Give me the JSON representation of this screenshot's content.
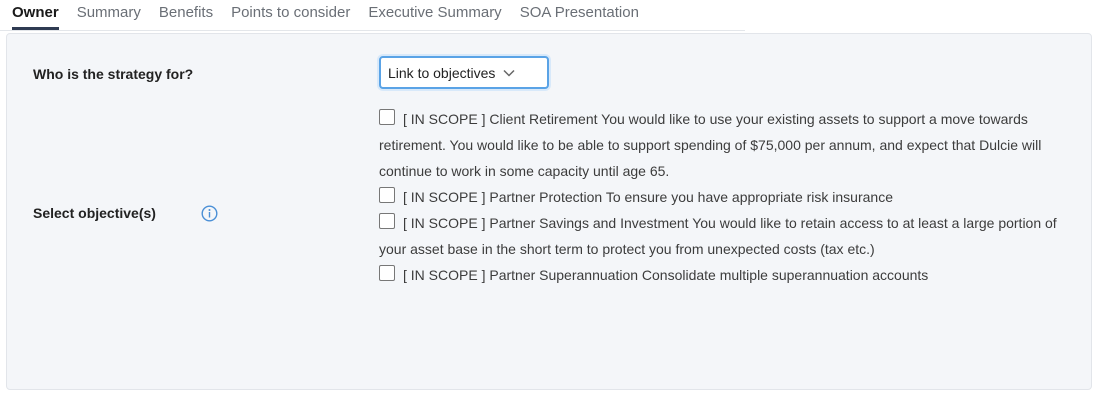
{
  "tabs": [
    {
      "label": "Owner",
      "active": true
    },
    {
      "label": "Summary"
    },
    {
      "label": "Benefits"
    },
    {
      "label": "Points to consider"
    },
    {
      "label": "Executive Summary"
    },
    {
      "label": "SOA Presentation"
    }
  ],
  "form": {
    "strategy_label": "Who is the strategy for?",
    "strategy_value": "Link to objectives",
    "objectives_label": "Select objective(s)",
    "objectives": [
      {
        "text": "[ IN SCOPE ] Client Retirement You would like to use your existing assets to support a move towards retirement. You would like to be able to support spending of $75,000 per annum, and expect that Dulcie will continue to work in some capacity until age 65.",
        "checked": false
      },
      {
        "text": "[ IN SCOPE ] Partner Protection To ensure you have appropriate risk insurance",
        "checked": false
      },
      {
        "text": "[ IN SCOPE ] Partner Savings and Investment You would like to retain access to at least a large portion of your asset base in the short term to protect you from unexpected costs (tax etc.)",
        "checked": false
      },
      {
        "text": "[ IN SCOPE ] Partner Superannuation Consolidate multiple superannuation accounts",
        "checked": false
      }
    ]
  },
  "colors": {
    "accent": "#5aa3e6",
    "active_tab_underline": "#2f3b52",
    "info_icon": "#4a8fd6",
    "panel_bg": "#f4f6f9"
  },
  "icons": {
    "info": "info-circle-icon",
    "dropdown": "chevron-down-icon"
  }
}
